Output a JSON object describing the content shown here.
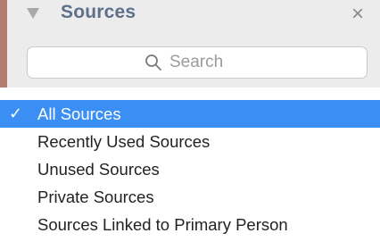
{
  "panel": {
    "title": "Sources",
    "close_glyph": "×",
    "disclosure_icon": "triangle-down-icon",
    "accent_color": "#b27d70"
  },
  "search": {
    "placeholder": "Search",
    "value": "",
    "icon": "search-icon"
  },
  "menu": {
    "selected_index": 0,
    "check_glyph": "✓",
    "highlight_color": "#3b8ef3",
    "items": [
      {
        "label": "All Sources"
      },
      {
        "label": "Recently Used Sources"
      },
      {
        "label": "Unused Sources"
      },
      {
        "label": "Private Sources"
      },
      {
        "label": "Sources Linked to Primary Person"
      }
    ]
  }
}
